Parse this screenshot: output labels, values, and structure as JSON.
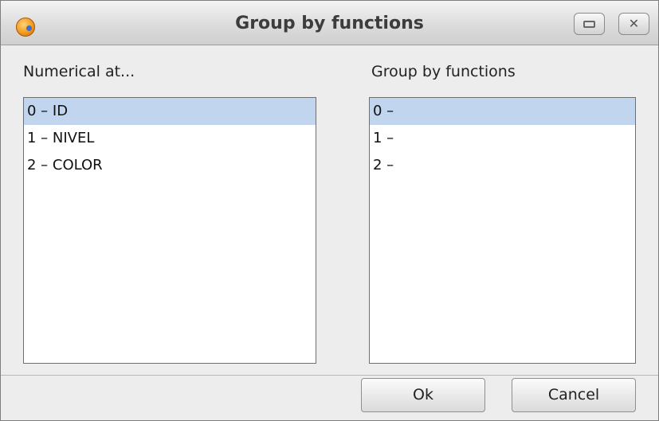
{
  "window": {
    "title": "Group by functions",
    "minimize_icon": "minimize-icon",
    "close_glyph": "✕"
  },
  "left_panel": {
    "label": "Numerical at...",
    "items": [
      {
        "label": "0 – ID",
        "selected": true
      },
      {
        "label": "1 – NIVEL",
        "selected": false
      },
      {
        "label": "2 – COLOR",
        "selected": false
      }
    ]
  },
  "right_panel": {
    "label": "Group by functions",
    "items": [
      {
        "label": "0 –",
        "selected": true
      },
      {
        "label": "1 –",
        "selected": false
      },
      {
        "label": "2 –",
        "selected": false
      }
    ]
  },
  "buttons": {
    "ok": "Ok",
    "cancel": "Cancel"
  },
  "colors": {
    "selection": "#c2d5ee",
    "app_icon": "#f39a1d"
  }
}
